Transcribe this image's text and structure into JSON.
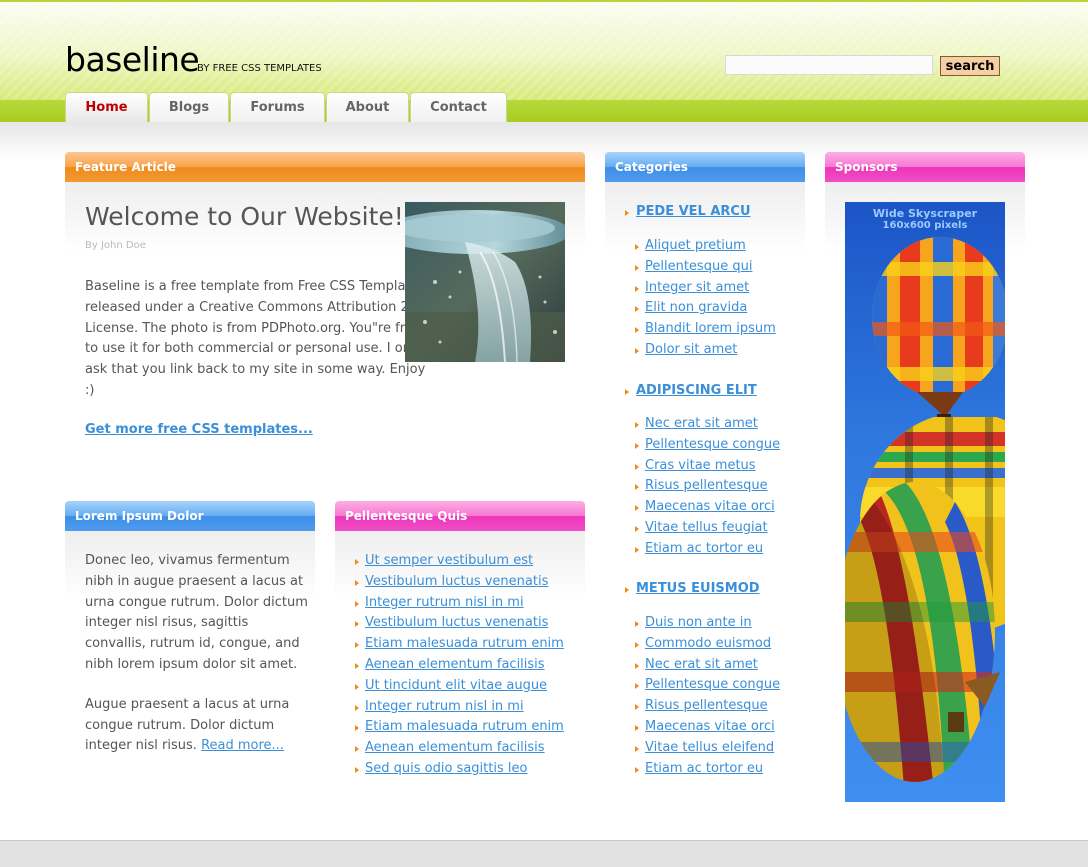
{
  "header": {
    "logo": "baseline",
    "logo_sub": "BY FREE CSS TEMPLATES",
    "search_button": "search",
    "search_value": ""
  },
  "nav": {
    "tabs": [
      {
        "label": "Home",
        "active": true
      },
      {
        "label": "Blogs"
      },
      {
        "label": "Forums"
      },
      {
        "label": "About"
      },
      {
        "label": "Contact"
      }
    ]
  },
  "feature": {
    "header": "Feature Article",
    "title": "Welcome to Our Website!",
    "byline": "By John Doe",
    "body": "Baseline is a free template from Free CSS Templates released under a Creative Commons Attribution 2.5 License. The photo is from PDPhoto.org. You\"re free to use it for both commercial or personal use. I only ask that you link back to my site in some way. Enjoy :)",
    "link": "Get more free CSS templates..."
  },
  "lorem": {
    "header": "Lorem Ipsum Dolor",
    "para1": "Donec leo, vivamus fermentum nibh in augue praesent a lacus at urna congue rutrum. Dolor dictum integer nisl risus, sagittis convallis, rutrum id, congue, and nibh lorem ipsum dolor sit amet.",
    "para2": "Augue praesent a lacus at urna congue rutrum. Dolor dictum integer nisl risus.",
    "read_more": "Read more..."
  },
  "pellentesque": {
    "header": "Pellentesque Quis",
    "items": [
      "Ut semper vestibulum est",
      "Vestibulum luctus venenatis",
      "Integer rutrum nisl in mi",
      "Vestibulum luctus venenatis",
      "Etiam malesuada rutrum enim",
      "Aenean elementum facilisis",
      "Ut tincidunt elit vitae augue",
      "Integer rutrum nisl in mi",
      "Etiam malesuada rutrum enim",
      "Aenean elementum facilisis",
      "Sed quis odio sagittis leo"
    ]
  },
  "categories": {
    "header": "Categories",
    "groups": [
      {
        "title": "PEDE VEL ARCU",
        "items": [
          "Aliquet pretium",
          "Pellentesque qui",
          "Integer sit amet",
          "Elit non gravida",
          "Blandit lorem ipsum",
          "Dolor sit amet"
        ]
      },
      {
        "title": "ADIPISCING ELIT",
        "items": [
          "Nec erat sit amet",
          "Pellentesque congue",
          "Cras vitae metus",
          "Risus pellentesque",
          "Maecenas vitae orci",
          "Vitae tellus feugiat",
          "Etiam ac tortor eu"
        ]
      },
      {
        "title": "METUS EUISMOD",
        "items": [
          "Duis non ante in",
          "Commodo euismod",
          "Nec erat sit amet",
          "Pellentesque congue",
          "Risus pellentesque",
          "Maecenas vitae orci",
          "Vitae tellus eleifend",
          "Etiam ac tortor eu"
        ]
      }
    ]
  },
  "sponsors": {
    "header": "Sponsors",
    "ad_label": "Wide Skyscraper",
    "ad_size": "160x600 pixels"
  },
  "colors": {
    "header_green": "#a9cc22",
    "link_blue": "#3a8fd8",
    "orange": "#ef8a1c",
    "blue": "#3d8ee9",
    "pink": "#ec35bb",
    "active_tab": "#c00000"
  }
}
